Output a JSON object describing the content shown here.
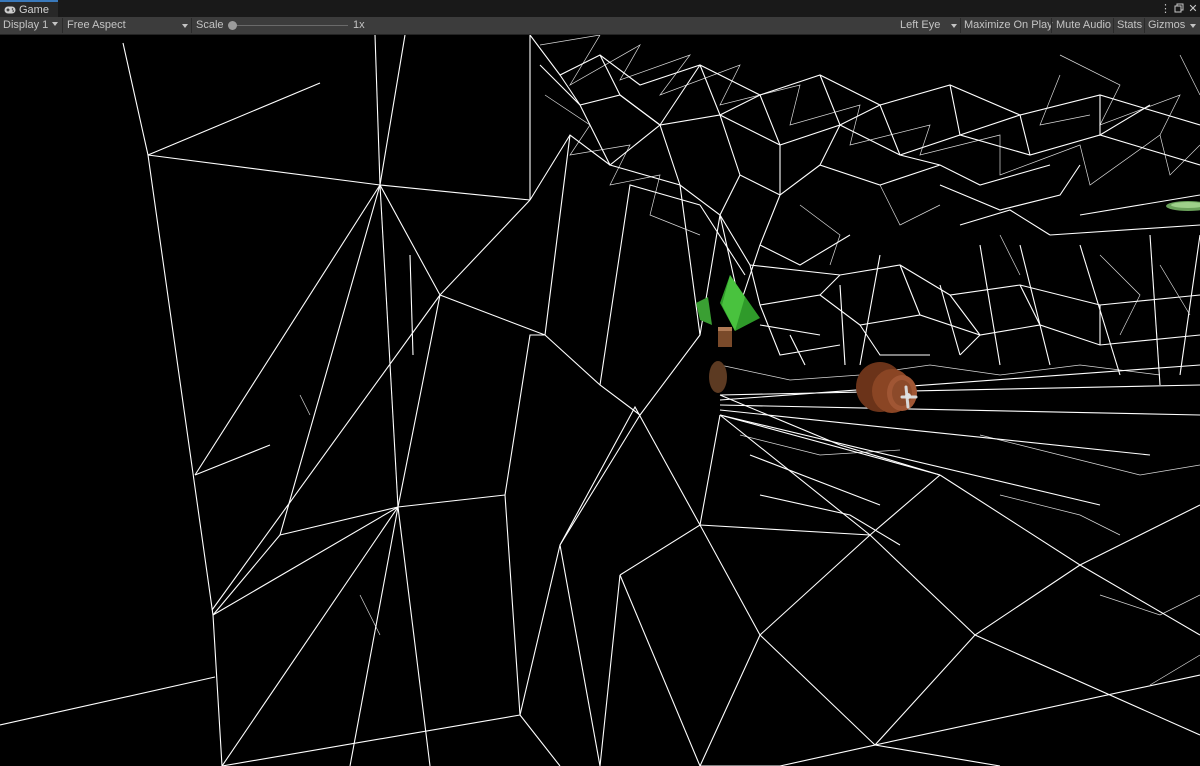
{
  "window": {
    "tab_title": "Game",
    "tab_icon": "gamepad-icon",
    "controls": [
      "more-options-icon",
      "maximize-icon",
      "close-icon"
    ]
  },
  "toolbar": {
    "display": "Display 1",
    "aspect": "Free Aspect",
    "scale_label": "Scale",
    "scale_value": "1x",
    "scale_slider_fraction": 0.0,
    "eye": "Left Eye",
    "maximize_on_play": "Maximize On Play",
    "mute_audio": "Mute Audio",
    "stats": "Stats",
    "gizmos": "Gizmos"
  },
  "viewport": {
    "render_mode": "wireframe",
    "background": "#000000",
    "wire_color": "#ffffff",
    "objects": [
      "green-cone-object",
      "brown-barrel-object",
      "green-disc-object"
    ]
  },
  "colors": {
    "tab_accent": "#3a79bb",
    "toolbar_bg": "#3c3c3c",
    "titlebar_bg": "#191919"
  }
}
